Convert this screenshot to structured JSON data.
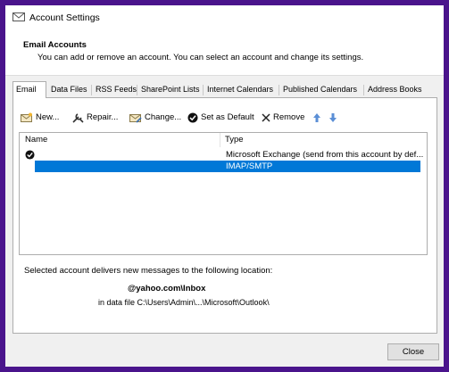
{
  "window": {
    "title": "Account Settings"
  },
  "header": {
    "title": "Email Accounts",
    "description": "You can add or remove an account. You can select an account and change its settings."
  },
  "tabs": [
    {
      "label": "Email"
    },
    {
      "label": "Data Files"
    },
    {
      "label": "RSS Feeds"
    },
    {
      "label": "SharePoint Lists"
    },
    {
      "label": "Internet Calendars"
    },
    {
      "label": "Published Calendars"
    },
    {
      "label": "Address Books"
    }
  ],
  "toolbar": {
    "new_label": "New...",
    "repair_label": "Repair...",
    "change_label": "Change...",
    "set_default_label": "Set as Default",
    "remove_label": "Remove"
  },
  "accounts": {
    "columns": {
      "name": "Name",
      "type": "Type"
    },
    "rows": [
      {
        "name": "",
        "type": "Microsoft Exchange (send from this account by def..."
      },
      {
        "name": "",
        "type": "IMAP/SMTP"
      }
    ]
  },
  "location": {
    "intro": "Selected account delivers new messages to the following location:",
    "folder": "@yahoo.com\\Inbox",
    "data_file": "in data file C:\\Users\\Admin\\...\\Microsoft\\Outlook\\"
  },
  "footer": {
    "close_label": "Close"
  },
  "colors": {
    "selection": "#0078d7",
    "frame": "#4a148c"
  }
}
